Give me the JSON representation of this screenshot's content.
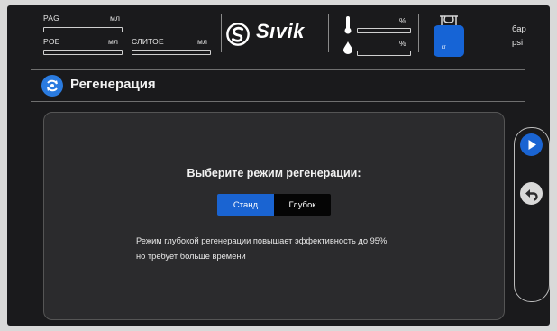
{
  "header": {
    "pag_label": "PAG",
    "pag_unit": "мл",
    "poe_label": "POE",
    "poe_unit": "мл",
    "drain_label": "СЛИТОЕ",
    "drain_unit": "мл",
    "brand": "Sıvik",
    "percent_a": "%",
    "percent_b": "%",
    "tank_unit": "кг",
    "pressure_unit_a": "бар",
    "pressure_unit_b": "psi"
  },
  "page": {
    "title": "Регенерация",
    "prompt": "Выберите режим регенерации:",
    "modes": [
      "Станд",
      "Глубок"
    ],
    "selected_mode": "Станд",
    "note_line1": "Режим глубокой регенерации повышает эффективность до 95%,",
    "note_line2": "но требует больше времени"
  },
  "colors": {
    "accent": "#1a64d2",
    "background": "#1a1a1c",
    "panel": "#2b2b2d"
  },
  "icons": {
    "logo": "sivik-logo-icon",
    "thermometer": "thermometer-icon",
    "droplet": "droplet-icon",
    "tank": "refrigerant-tank-icon",
    "title": "regeneration-icon",
    "next": "play-icon",
    "back": "back-arrow-icon"
  }
}
